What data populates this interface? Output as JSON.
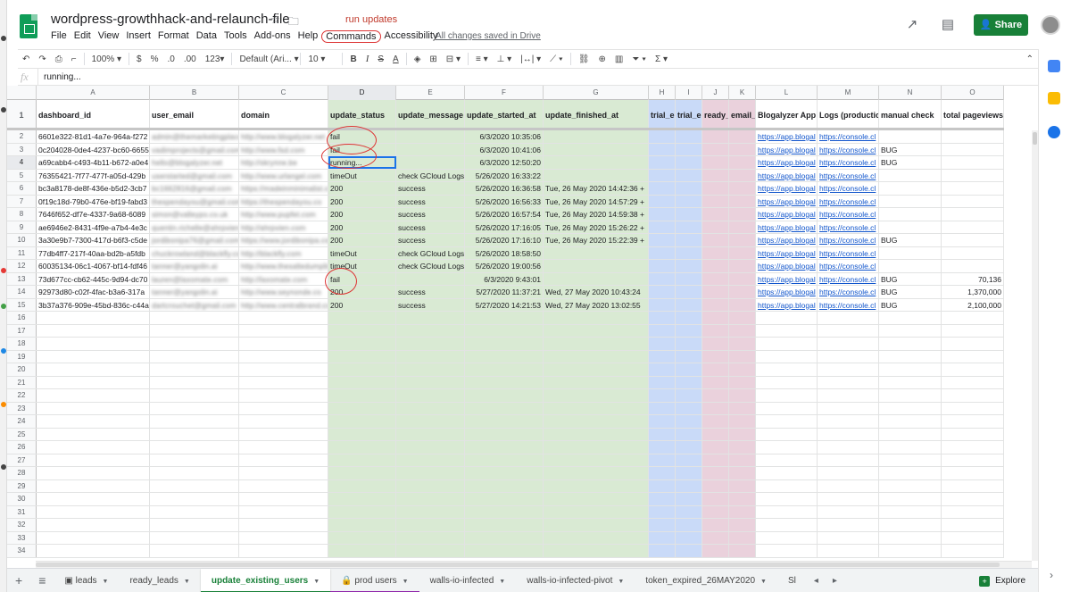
{
  "document": {
    "title": "wordpress-growthhack-and-relaunch-file",
    "saved_status": "All changes saved in Drive",
    "annotation_label": "run updates"
  },
  "menu": [
    "File",
    "Edit",
    "View",
    "Insert",
    "Format",
    "Data",
    "Tools",
    "Add-ons",
    "Help",
    "Commands",
    "Accessibility"
  ],
  "header": {
    "share_label": "Share"
  },
  "toolbar": {
    "zoom": "100%",
    "currency": "$",
    "percent": "%",
    "decimal_less": ".0",
    "decimal_more": ".00",
    "number_format": "123",
    "font": "Default (Ari...",
    "font_size": "10",
    "bold": "B",
    "italic": "I",
    "strike": "S",
    "text_color": "A",
    "functions": "Σ"
  },
  "formula_bar": {
    "fx_label": "fx",
    "value": "running..."
  },
  "columns": [
    "A",
    "B",
    "C",
    "D",
    "E",
    "F",
    "G",
    "H",
    "I",
    "J",
    "K",
    "L",
    "M",
    "N",
    "O"
  ],
  "table": {
    "headers": [
      "dashboard_id",
      "user_email",
      "domain",
      "update_status",
      "update_message",
      "update_started_at",
      "update_finished_at",
      "trial_e",
      "trial_e",
      "ready_",
      "email_",
      "Blogalyzer App",
      "Logs (productio",
      "manual check",
      "total pageviews"
    ],
    "rows": [
      [
        "6601e322-81d1-4a7e-964a-f272",
        "admin@themarketingplace.net",
        "http://www.blogalyzer.net",
        "fail",
        "",
        "6/3/2020 10:35:06",
        "",
        "",
        "",
        "",
        "",
        "https://app.blogal",
        "https://console.cl",
        "",
        ""
      ],
      [
        "0c204028-0de4-4237-bc60-6655",
        "vadimprojects@gmail.com",
        "http://www.fsd.com",
        "fail",
        "",
        "6/3/2020 10:41:06",
        "",
        "",
        "",
        "",
        "",
        "https://app.blogal",
        "https://console.cl",
        "BUG",
        ""
      ],
      [
        "a69cabb4-c493-4b11-b672-a0e4",
        "hello@blogalyzer.net",
        "http://skrynne.be",
        "running...",
        "",
        "6/3/2020 12:50:20",
        "",
        "",
        "",
        "",
        "",
        "https://app.blogal",
        "https://console.cl",
        "BUG",
        ""
      ],
      [
        "76355421-7f77-477f-a05d-429b",
        "userstarted@gmail.com",
        "http://www.urlangel.com",
        "timeOut",
        "check GCloud Logs",
        "5/26/2020 16:33:22",
        "",
        "",
        "",
        "",
        "",
        "https://app.blogal",
        "https://console.cl",
        "",
        ""
      ],
      [
        "bc3a8178-de8f-436e-b5d2-3cb7",
        "bc1662816@gmail.com",
        "https://madeinminimalist.co",
        "200",
        "success",
        "5/26/2020 16:36:58",
        "Tue, 26 May 2020 14:42:36 +",
        "",
        "",
        "",
        "",
        "https://app.blogal",
        "https://console.cl",
        "",
        ""
      ],
      [
        "0f19c18d-79b0-476e-bf19-fabd3",
        "thespendayou@gmail.com",
        "https://thespendayou.co",
        "200",
        "success",
        "5/26/2020 16:56:33",
        "Tue, 26 May 2020 14:57:29 +",
        "",
        "",
        "",
        "",
        "https://app.blogal",
        "https://console.cl",
        "",
        ""
      ],
      [
        "7646f652-df7e-4337-9a68-6089",
        "simon@valleypo.co.uk",
        "http://www.pupfet.com",
        "200",
        "success",
        "5/26/2020 16:57:54",
        "Tue, 26 May 2020 14:59:38 +",
        "",
        "",
        "",
        "",
        "https://app.blogal",
        "https://console.cl",
        "",
        ""
      ],
      [
        "ae6946e2-8431-4f9e-a7b4-4e3c",
        "quentin.richelle@ahrpvien.net",
        "http://ahrpvien.com",
        "200",
        "success",
        "5/26/2020 17:16:05",
        "Tue, 26 May 2020 15:26:22 +",
        "",
        "",
        "",
        "",
        "https://app.blogal",
        "https://console.cl",
        "",
        ""
      ],
      [
        "3a30e9b7-7300-417d-b6f3-c5de",
        "jordibonipa76@gmail.com",
        "https://www.jordibonipa.com",
        "200",
        "success",
        "5/26/2020 17:16:10",
        "Tue, 26 May 2020 15:22:39 +",
        "",
        "",
        "",
        "",
        "https://app.blogal",
        "https://console.cl",
        "BUG",
        ""
      ],
      [
        "77db4ff7-217f-40aa-bd2b-a5fdb",
        "chuckrowland@blackfly.com",
        "http://blackfly.com",
        "timeOut",
        "check GCloud Logs",
        "5/26/2020 18:58:50",
        "",
        "",
        "",
        "",
        "",
        "https://app.blogal",
        "https://console.cl",
        "",
        ""
      ],
      [
        "60035134-06c1-4067-bf14-fdf46",
        "tanner@yangolin.ai",
        "http://www.thesaltedumpling.co",
        "timeOut",
        "check GCloud Logs",
        "5/26/2020 19:00:56",
        "",
        "",
        "",
        "",
        "",
        "https://app.blogal",
        "https://console.cl",
        "",
        ""
      ],
      [
        "73d677cc-cb62-445c-9d94-dc70",
        "lauren@laxomate.com",
        "http://laxomate.com",
        "fail",
        "",
        "6/3/2020 9:43:01",
        "",
        "",
        "",
        "",
        "",
        "https://app.blogal",
        "https://console.cl",
        "BUG",
        "70,136"
      ],
      [
        "92973d80-c02f-4fac-b3a6-317a",
        "tanner@yangolin.ai",
        "http://www.seynonde.co",
        "200",
        "success",
        "5/27/2020 11:37:21",
        "Wed, 27 May 2020 10:43:24",
        "",
        "",
        "",
        "",
        "https://app.blogal",
        "https://console.cl",
        "BUG",
        "1,370,000"
      ],
      [
        "3b37a376-909e-45bd-836c-c44a",
        "dartcrouchet@gmail.com",
        "http://www.centralbrand.com",
        "200",
        "success",
        "5/27/2020 14:21:53",
        "Wed, 27 May 2020 13:02:55",
        "",
        "",
        "",
        "",
        "https://app.blogal",
        "https://console.cl",
        "BUG",
        "2,100,000"
      ]
    ],
    "total_rows": 34
  },
  "sheet_tabs": [
    {
      "label": "leads",
      "locked": false
    },
    {
      "label": "ready_leads",
      "locked": false
    },
    {
      "label": "update_existing_users",
      "locked": false,
      "active": true
    },
    {
      "label": "prod users",
      "locked": true
    },
    {
      "label": "walls-io-infected",
      "locked": false
    },
    {
      "label": "walls-io-infected-pivot",
      "locked": false
    },
    {
      "label": "token_expired_26MAY2020",
      "locked": false
    },
    {
      "label": "Sl",
      "locked": false
    }
  ],
  "explore_label": "Explore",
  "colors": {
    "green_accent": "#188038",
    "green_cols": "#d9ead3",
    "blue_cols": "#c9daf8",
    "pink_cols": "#ead1dc",
    "annotation_red": "#d33",
    "link": "#1155cc"
  }
}
